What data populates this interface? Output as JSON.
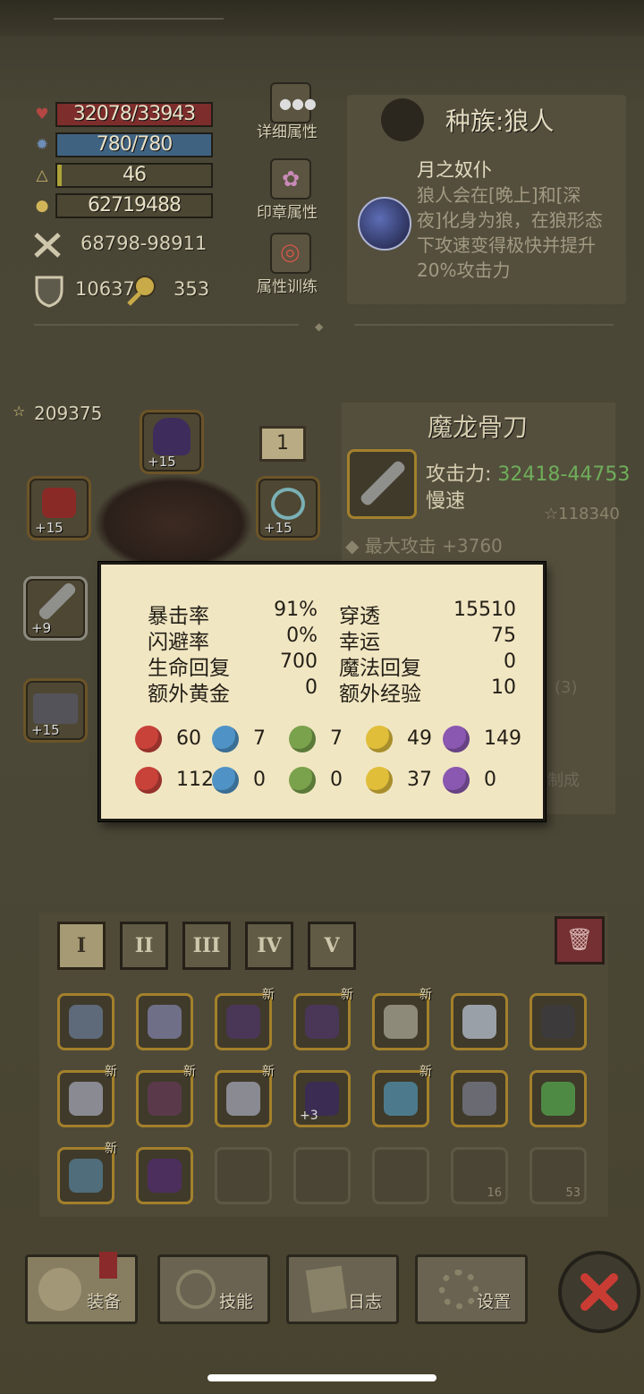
{
  "stats": {
    "hp": "32078/33943",
    "mp": "780/780",
    "level": "46",
    "gold": "62719488",
    "level_progress_percent": 3,
    "attack_range": "68798-98911",
    "armor": "10637",
    "crit_power": "353"
  },
  "side_buttons": {
    "detail": "详细属性",
    "seal": "印章属性",
    "training": "属性训练"
  },
  "race": {
    "title": "种族:狼人",
    "skill_name": "月之奴仆",
    "description": "狼人会在[晚上]和[深夜]化身为狼，在狼形态下攻速变得极快并提升20%攻击力"
  },
  "equipment": {
    "score": "209375",
    "slot_levels": {
      "helmet": "+15",
      "left_top": "+15",
      "right_top": "+15",
      "weapon": "+9",
      "left_bottom": "+15"
    },
    "badge": "1"
  },
  "item": {
    "name": "魔龙骨刀",
    "attack_label": "攻击力:",
    "attack_value": "32418-44753",
    "speed": "慢速",
    "score": "118340",
    "bonus": "最大攻击 +3760",
    "partial_3": "(3)",
    "partial_made": "制成"
  },
  "tooltip": {
    "rows": [
      {
        "l": "暴击率",
        "lv": "91%",
        "r": "穿透",
        "rv": "15510"
      },
      {
        "l": "闪避率",
        "lv": "0%",
        "r": "幸运",
        "rv": "75"
      },
      {
        "l": "生命回复",
        "lv": "700",
        "r": "魔法回复",
        "rv": "0"
      },
      {
        "l": "额外黄金",
        "lv": "0",
        "r": "额外经验",
        "rv": "10"
      }
    ],
    "elements_row1": [
      "60",
      "7",
      "7",
      "49",
      "149"
    ],
    "elements_row2": [
      "112",
      "0",
      "0",
      "37",
      "0"
    ]
  },
  "inventory": {
    "tabs": [
      "I",
      "II",
      "III",
      "IV",
      "V"
    ],
    "active_tab": 0,
    "new_label": "新",
    "plus3": "+3",
    "count_16": "16",
    "count_53": "53"
  },
  "nav": {
    "equip": "装备",
    "skill": "技能",
    "log": "日志",
    "settings": "设置"
  },
  "colors": {
    "hp": "#7d2d2c",
    "mp": "#3f6281",
    "attack_green": "#6fae5a",
    "inventory_border": "#a3802b"
  }
}
